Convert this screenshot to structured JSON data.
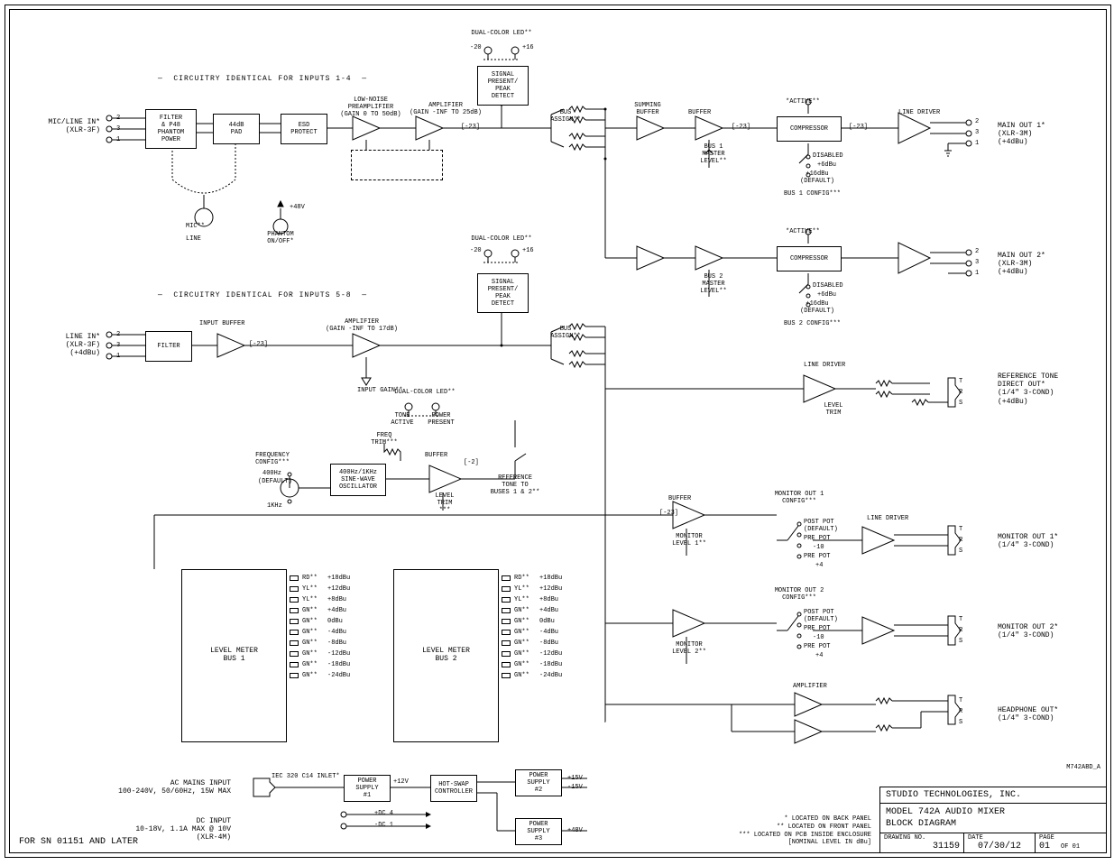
{
  "company": "STUDIO TECHNOLOGIES, INC.",
  "title1": "MODEL 742A AUDIO MIXER",
  "title2": "BLOCK DIAGRAM",
  "drawing_no_label": "DRAWING NO.",
  "drawing_no": "31159",
  "date_label": "DATE",
  "date": "07/30/12",
  "page_label": "PAGE",
  "page": "01",
  "page_of": "OF  01",
  "doc_id": "M742ABD_A",
  "sn_note": "FOR SN 01151 AND LATER",
  "legend": {
    "a": "* LOCATED ON BACK PANEL",
    "b": "** LOCATED ON FRONT PANEL",
    "c": "*** LOCATED ON PCB INSIDE ENCLOSURE",
    "d": "[NOMINAL LEVEL IN dBu]"
  },
  "io": {
    "mic_in": "MIC/LINE IN*",
    "mic_in_conn": "(XLR-3F)",
    "line_in": "LINE IN*",
    "line_in_conn": "(XLR-3F)",
    "line_in_level": "(+4dBu)",
    "main1": "MAIN OUT 1*",
    "main1_conn": "(XLR-3M)",
    "main1_level": "(+4dBu)",
    "main2": "MAIN OUT 2*",
    "main2_conn": "(XLR-3M)",
    "main2_level": "(+4dBu)",
    "refout": "REFERENCE TONE",
    "refout2": "DIRECT OUT*",
    "refout_conn": "(1/4\" 3-COND)",
    "refout_level": "(+4dBu)",
    "mon1": "MONITOR OUT 1*",
    "mon1_conn": "(1/4\" 3-COND)",
    "mon2": "MONITOR OUT 2*",
    "mon2_conn": "(1/4\" 3-COND)",
    "hp": "HEADPHONE OUT*",
    "hp_conn": "(1/4\" 3-COND)",
    "ac": "AC MAINS INPUT",
    "ac_spec": "100-240V, 50/60Hz, 15W MAX",
    "dc": "DC INPUT",
    "dc_spec": "10-18V, 1.1A MAX @ 10V",
    "dc_conn": "(XLR-4M)"
  },
  "sections": {
    "s14": "CIRCUITRY IDENTICAL FOR INPUTS 1-4",
    "s58": "CIRCUITRY IDENTICAL FOR INPUTS 5-8"
  },
  "blocks": {
    "filter_p48": "FILTER\n& P48\nPHANTOM\nPOWER",
    "pad": "44dB\nPAD",
    "esd": "ESD\nPROTECT",
    "preamp_label": "LOW-NOISE\nPREAMPLIFIER\n(GAIN 0 TO 50dB)",
    "amp1_label": "AMPLIFIER\n(GAIN -INF TO 25dB)",
    "filter": "FILTER",
    "amp2_label": "AMPLIFIER\n(GAIN -INF TO 17dB)",
    "input_buffer": "INPUT BUFFER",
    "detect": "SIGNAL\nPRESENT/\nPEAK\nDETECT",
    "dual_led": "DUAL-COLOR LED**",
    "bus_assign": "BUS\nASSIGN**",
    "sum_buf": "SUMMING\nBUFFER",
    "buffer": "BUFFER",
    "compressor": "COMPRESSOR",
    "line_driver": "LINE DRIVER",
    "amplifier": "AMPLIFIER",
    "osc": "400Hz/1KHz\nSINE-WAVE\nOSCILLATOR",
    "hotswap": "HOT-SWAP\nCONTROLLER",
    "ps1": "POWER\nSUPPLY\n#1",
    "ps2": "POWER\nSUPPLY\n#2",
    "ps3": "POWER\nSUPPLY\n#3",
    "meter1": "LEVEL METER\nBUS 1",
    "meter2": "LEVEL METER\nBUS 2",
    "iec": "IEC 320 C14 INLET*"
  },
  "labels": {
    "mic": "MIC**",
    "line": "LINE",
    "p48v": "+48V",
    "phantom_onoff": "PHANTOM\nON/OFF*",
    "input_gain": "INPUT GAIN**",
    "minus23": "[-23]",
    "minus2": "[-2]",
    "minus20": "-20",
    "plus16": "+16",
    "active": "*ACTIVE**",
    "disabled": "DISABLED",
    "plus6dbu": "+6dBu",
    "plus16dbu": "+16dBu",
    "default": "(DEFAULT)",
    "bus1cfg": "BUS 1 CONFIG***",
    "bus2cfg": "BUS 2 CONFIG***",
    "bus1master": "BUS 1\nMASTER\nLEVEL**",
    "bus2master": "BUS 2\nMASTER\nLEVEL**",
    "tone_active": "TONE\nACTIVE",
    "power_present": "POWER\nPRESENT",
    "reftone": "REFERENCE\nTONE TO\nBUSES 1 & 2**",
    "freq_cfg": "FREQUENCY\nCONFIG***",
    "hz400": "400Hz",
    "default2": "(DEFAULT)",
    "hz1k": "1KHz",
    "freq_trim": "FREQ\nTRIM***",
    "level_trim": "LEVEL\nTRIM",
    "level_trim3": "LEVEL\nTRIM\n***",
    "mon1cfg": "MONITOR OUT 1\nCONFIG***",
    "mon2cfg": "MONITOR OUT 2\nCONFIG***",
    "monlvl1": "MONITOR\nLEVEL 1**",
    "monlvl2": "MONITOR\nLEVEL 2**",
    "post": "POST POT",
    "pre": "PRE POT",
    "m10": "-10",
    "p4": "+4",
    "p12v": "+12V",
    "p15v": "+15V",
    "m15v": "-15V",
    "p48v_out": "+48V",
    "dc4": "+DC 4",
    "dc1": "-DC 1",
    "rd": "RD**",
    "yl": "YL**",
    "gn": "GN**",
    "pins": {
      "p1": "1",
      "p2": "2",
      "p3": "3",
      "t": "T",
      "r": "R",
      "s": "S"
    }
  },
  "meter": {
    "levels": [
      "+18dBu",
      "+12dBu",
      "+8dBu",
      "+4dBu",
      "0dBu",
      "-4dBu",
      "-8dBu",
      "-12dBu",
      "-18dBu",
      "-24dBu"
    ],
    "colors": [
      "rd",
      "yl",
      "yl",
      "gn",
      "gn",
      "gn",
      "gn",
      "gn",
      "gn",
      "gn"
    ]
  }
}
